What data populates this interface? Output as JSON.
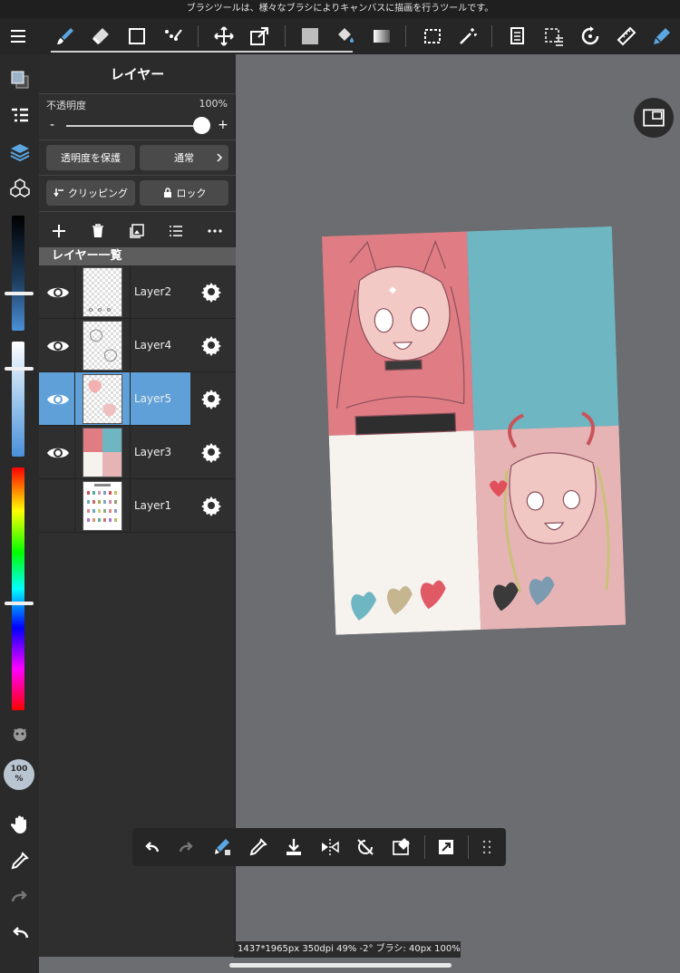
{
  "hint_text": "ブラシツールは、様々なブラシによりキャンバスに描画を行うツールです。",
  "colors": {
    "accent": "#4a90d9",
    "selected_layer": "#5fa0d8",
    "toolbar_bg": "#262626",
    "canvas_bg": "#6b6d70"
  },
  "toolbar": {
    "tools": [
      "menu-icon",
      "brush-icon",
      "eraser-icon",
      "shape-icon",
      "dot-icon",
      "move-icon",
      "transform-icon",
      "fill-color-icon",
      "bucket-icon",
      "gradient-icon",
      "select-icon",
      "magic-wand-icon",
      "layer-copy-icon",
      "select-settings-icon",
      "rotate-icon",
      "ruler-icon",
      "pen-settings-icon"
    ]
  },
  "layer_panel": {
    "title": "レイヤー",
    "opacity_label": "不透明度",
    "opacity_value": "100%",
    "opacity": 100,
    "minus": "-",
    "plus": "+",
    "protect_alpha": "透明度を保護",
    "blend_mode": "通常",
    "clipping": "クリッピング",
    "lock": "ロック",
    "list_title": "レイヤー一覧",
    "layers": [
      {
        "name": "Layer2",
        "visible": true,
        "selected": false
      },
      {
        "name": "Layer4",
        "visible": true,
        "selected": false
      },
      {
        "name": "Layer5",
        "visible": true,
        "selected": true
      },
      {
        "name": "Layer3",
        "visible": true,
        "selected": false
      },
      {
        "name": "Layer1",
        "visible": false,
        "selected": false
      }
    ]
  },
  "rail": {
    "zoom_badge_top": "100",
    "zoom_badge_bottom": "%"
  },
  "status_bar": "1437*1965px 350dpi 49% -2° ブラシ: 40px 100%"
}
